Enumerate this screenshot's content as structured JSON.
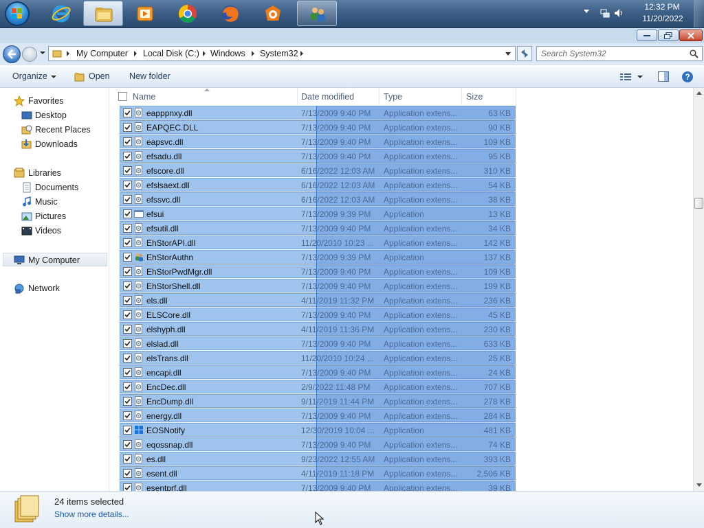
{
  "taskbar": {
    "apps": [
      {
        "name": "Internet Explorer",
        "icon": "ie-icon"
      },
      {
        "name": "Windows Explorer",
        "icon": "folder-icon"
      },
      {
        "name": "Media Player",
        "icon": "media-icon"
      },
      {
        "name": "Google Chrome",
        "icon": "chrome-icon"
      },
      {
        "name": "Firefox",
        "icon": "firefox-icon"
      },
      {
        "name": "Avast",
        "icon": "avast-icon"
      },
      {
        "name": "Users",
        "icon": "users-icon"
      }
    ],
    "clock_time": "12:32 PM",
    "clock_date": "11/20/2022"
  },
  "address": {
    "crumbs": [
      "My Computer",
      "Local Disk (C:)",
      "Windows",
      "System32"
    ],
    "search_placeholder": "Search System32"
  },
  "toolbar": {
    "organize": "Organize",
    "open": "Open",
    "new_folder": "New folder"
  },
  "nav": {
    "favorites": "Favorites",
    "desktop": "Desktop",
    "recent": "Recent Places",
    "downloads": "Downloads",
    "libraries": "Libraries",
    "documents": "Documents",
    "music": "Music",
    "pictures": "Pictures",
    "videos": "Videos",
    "computer": "My Computer",
    "network": "Network"
  },
  "columns": {
    "name": "Name",
    "date": "Date modified",
    "type": "Type",
    "size": "Size"
  },
  "files": [
    {
      "name": "eapppnxy.dll",
      "date": "7/13/2009 9:40 PM",
      "type": "Application extens...",
      "size": "63 KB",
      "icon": "dll-icon"
    },
    {
      "name": "EAPQEC.DLL",
      "date": "7/13/2009 9:40 PM",
      "type": "Application extens...",
      "size": "90 KB",
      "icon": "dll-icon"
    },
    {
      "name": "eapsvc.dll",
      "date": "7/13/2009 9:40 PM",
      "type": "Application extens...",
      "size": "109 KB",
      "icon": "dll-icon"
    },
    {
      "name": "efsadu.dll",
      "date": "7/13/2009 9:40 PM",
      "type": "Application extens...",
      "size": "95 KB",
      "icon": "dll-icon"
    },
    {
      "name": "efscore.dll",
      "date": "6/16/2022 12:03 AM",
      "type": "Application extens...",
      "size": "310 KB",
      "icon": "dll-icon"
    },
    {
      "name": "efslsaext.dll",
      "date": "6/16/2022 12:03 AM",
      "type": "Application extens...",
      "size": "54 KB",
      "icon": "dll-icon"
    },
    {
      "name": "efssvc.dll",
      "date": "6/16/2022 12:03 AM",
      "type": "Application extens...",
      "size": "38 KB",
      "icon": "dll-icon"
    },
    {
      "name": "efsui",
      "date": "7/13/2009 9:39 PM",
      "type": "Application",
      "size": "13 KB",
      "icon": "exe-icon"
    },
    {
      "name": "efsutil.dll",
      "date": "7/13/2009 9:40 PM",
      "type": "Application extens...",
      "size": "34 KB",
      "icon": "dll-icon"
    },
    {
      "name": "EhStorAPI.dll",
      "date": "11/20/2010 10:23 ...",
      "type": "Application extens...",
      "size": "142 KB",
      "icon": "dll-icon"
    },
    {
      "name": "EhStorAuthn",
      "date": "7/13/2009 9:39 PM",
      "type": "Application",
      "size": "137 KB",
      "icon": "users-icon"
    },
    {
      "name": "EhStorPwdMgr.dll",
      "date": "7/13/2009 9:40 PM",
      "type": "Application extens...",
      "size": "109 KB",
      "icon": "dll-icon"
    },
    {
      "name": "EhStorShell.dll",
      "date": "7/13/2009 9:40 PM",
      "type": "Application extens...",
      "size": "199 KB",
      "icon": "dll-icon"
    },
    {
      "name": "els.dll",
      "date": "4/11/2019 11:32 PM",
      "type": "Application extens...",
      "size": "236 KB",
      "icon": "dll-icon"
    },
    {
      "name": "ELSCore.dll",
      "date": "7/13/2009 9:40 PM",
      "type": "Application extens...",
      "size": "45 KB",
      "icon": "dll-icon"
    },
    {
      "name": "elshyph.dll",
      "date": "4/11/2019 11:36 PM",
      "type": "Application extens...",
      "size": "230 KB",
      "icon": "dll-icon"
    },
    {
      "name": "elslad.dll",
      "date": "7/13/2009 9:40 PM",
      "type": "Application extens...",
      "size": "633 KB",
      "icon": "dll-icon"
    },
    {
      "name": "elsTrans.dll",
      "date": "11/20/2010 10:24 ...",
      "type": "Application extens...",
      "size": "25 KB",
      "icon": "dll-icon"
    },
    {
      "name": "encapi.dll",
      "date": "7/13/2009 9:40 PM",
      "type": "Application extens...",
      "size": "24 KB",
      "icon": "dll-icon"
    },
    {
      "name": "EncDec.dll",
      "date": "2/9/2022 11:48 PM",
      "type": "Application extens...",
      "size": "707 KB",
      "icon": "dll-icon"
    },
    {
      "name": "EncDump.dll",
      "date": "9/11/2019 11:44 PM",
      "type": "Application extens...",
      "size": "278 KB",
      "icon": "dll-icon"
    },
    {
      "name": "energy.dll",
      "date": "7/13/2009 9:40 PM",
      "type": "Application extens...",
      "size": "284 KB",
      "icon": "dll-icon"
    },
    {
      "name": "EOSNotify",
      "date": "12/30/2019 10:04 ...",
      "type": "Application",
      "size": "481 KB",
      "icon": "windows-icon"
    },
    {
      "name": "eqossnap.dll",
      "date": "7/13/2009 9:40 PM",
      "type": "Application extens...",
      "size": "74 KB",
      "icon": "dll-icon"
    },
    {
      "name": "es.dll",
      "date": "9/23/2022 12:55 AM",
      "type": "Application extens...",
      "size": "393 KB",
      "icon": "dll-icon"
    },
    {
      "name": "esent.dll",
      "date": "4/11/2019 11:18 PM",
      "type": "Application extens...",
      "size": "2,506 KB",
      "icon": "dll-icon"
    },
    {
      "name": "esentprf.dll",
      "date": "7/13/2009 9:40 PM",
      "type": "Application extens...",
      "size": "39 KB",
      "icon": "dll-icon"
    }
  ],
  "details": {
    "selection": "24 items selected",
    "more": "Show more details..."
  }
}
